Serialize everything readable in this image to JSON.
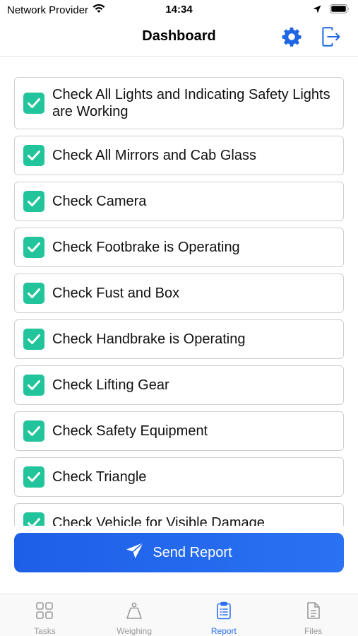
{
  "status_bar": {
    "carrier": "Network Provider",
    "time": "14:34"
  },
  "header": {
    "title": "Dashboard",
    "settings_icon": "gear-icon",
    "logout_icon": "logout-icon",
    "accent_color": "#1f66e5"
  },
  "checklist": {
    "check_color": "#22c59b",
    "items": [
      {
        "label": "Check All Lights and Indicating Safety Lights are Working",
        "checked": true
      },
      {
        "label": "Check All Mirrors and Cab Glass",
        "checked": true
      },
      {
        "label": "Check Camera",
        "checked": true
      },
      {
        "label": "Check Footbrake is Operating",
        "checked": true
      },
      {
        "label": "Check Fust and Box",
        "checked": true
      },
      {
        "label": "Check Handbrake is Operating",
        "checked": true
      },
      {
        "label": "Check Lifting Gear",
        "checked": true
      },
      {
        "label": "Check Safety Equipment",
        "checked": true
      },
      {
        "label": "Check Triangle",
        "checked": true
      },
      {
        "label": "Check Vehicle for Visible Damage",
        "checked": true
      }
    ]
  },
  "send_button": {
    "label": "Send Report",
    "icon": "paper-plane-icon"
  },
  "tabs": [
    {
      "label": "Tasks",
      "icon": "grid-icon",
      "active": false
    },
    {
      "label": "Weighing",
      "icon": "weight-icon",
      "active": false
    },
    {
      "label": "Report",
      "icon": "clipboard-icon",
      "active": true
    },
    {
      "label": "Files",
      "icon": "file-icon",
      "active": false
    }
  ]
}
